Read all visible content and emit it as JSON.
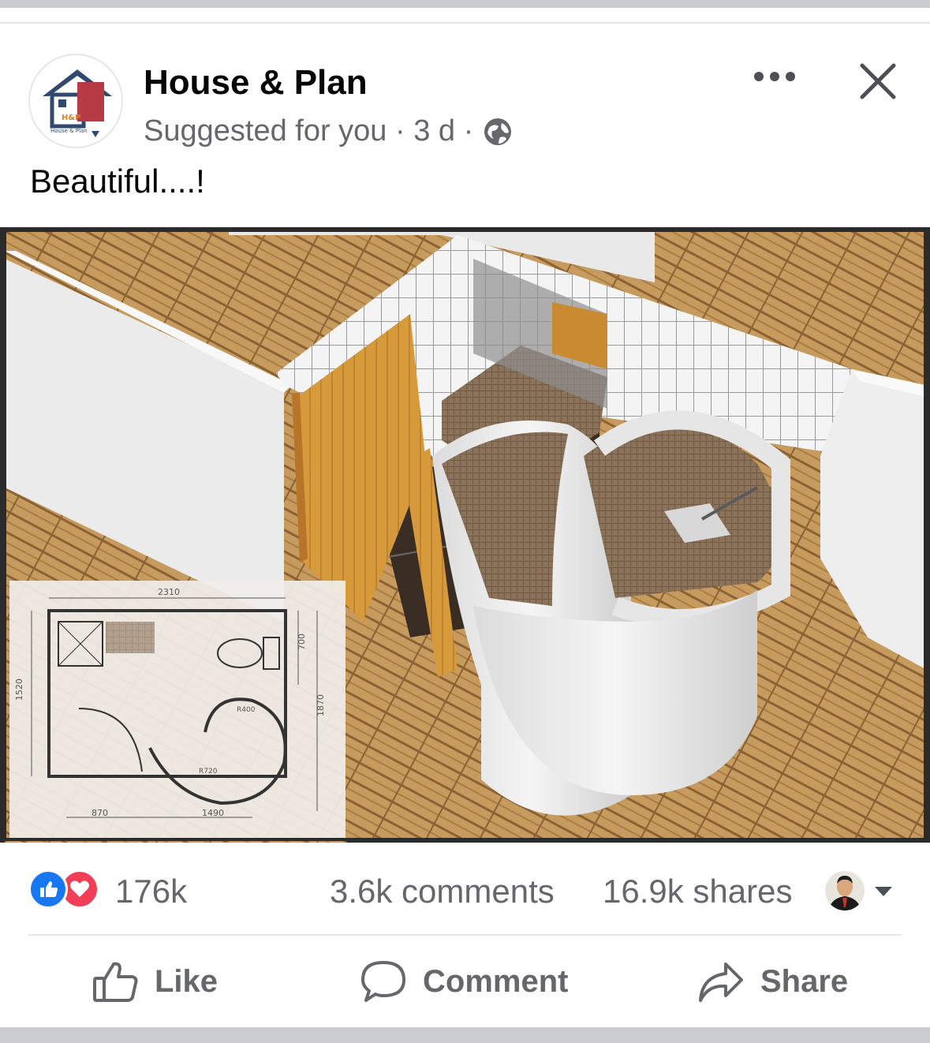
{
  "post": {
    "page_name": "House & Plan",
    "meta_text": "Suggested for you · 3 d ·",
    "audience_icon": "globe-icon",
    "caption": "Beautiful....!",
    "logo_text": "H&P",
    "logo_subtext": "House & Plan",
    "image_alt": "3D render of a bathroom with a curved shower enclosure and floor plan inset"
  },
  "plan_labels": {
    "top_width": "2310",
    "left_height": "1520",
    "right_height_top": "700",
    "right_height": "1870",
    "bottom_left": "870",
    "bottom_right": "1490",
    "radius_a": "R400",
    "radius_b": "R720"
  },
  "stats": {
    "reaction_count": "176k",
    "comments": "3.6k comments",
    "shares": "16.9k shares",
    "reaction_icons": [
      "like-icon",
      "love-icon"
    ]
  },
  "actions": {
    "like": "Like",
    "comment": "Comment",
    "share": "Share"
  },
  "colors": {
    "facebook_blue": "#1877f2",
    "love_red": "#f33e58",
    "secondary_text": "#65676b",
    "divider": "#e4e6eb"
  }
}
